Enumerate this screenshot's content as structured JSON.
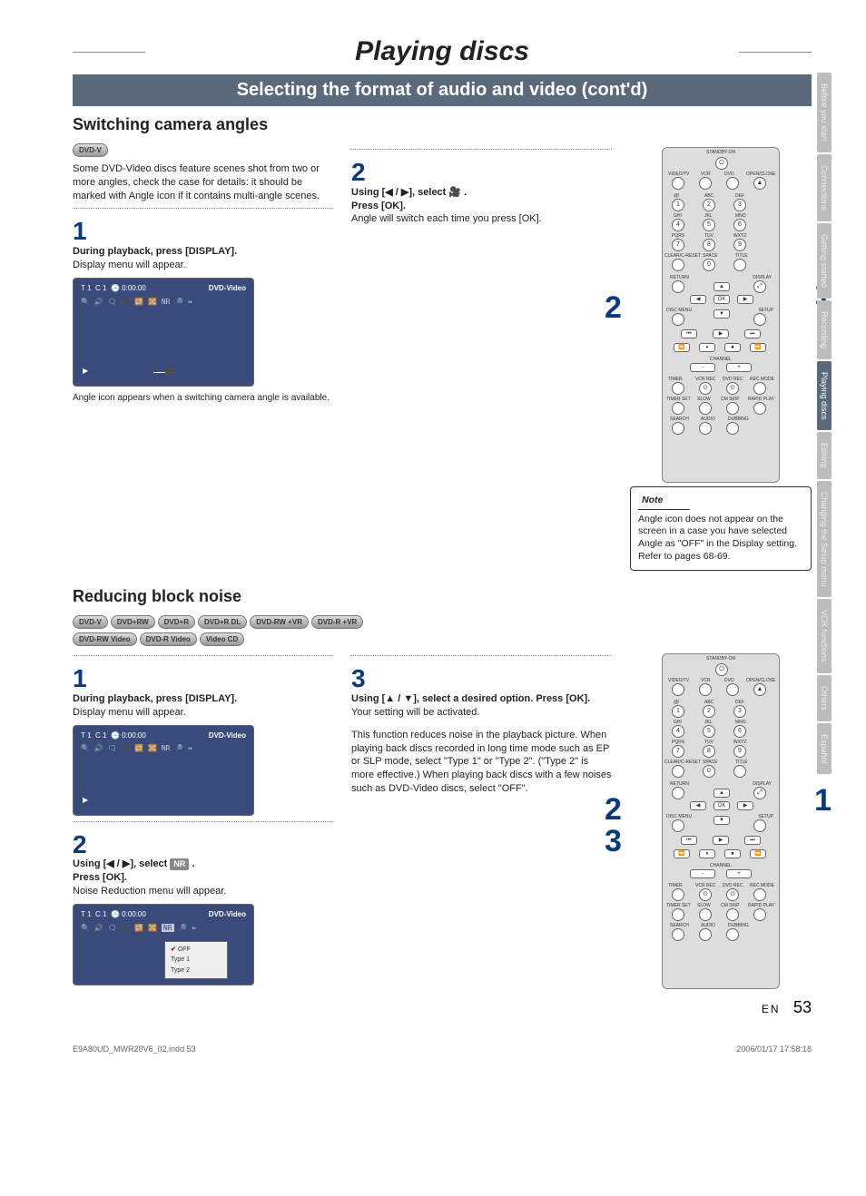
{
  "header": {
    "title": "Playing discs",
    "banner": "Selecting the format of audio and video (cont'd)"
  },
  "sidebar": {
    "tabs": [
      "Before you start",
      "Connections",
      "Getting started",
      "Recording",
      "Playing discs",
      "Editing",
      "Changing the Setup menu",
      "VCR functions",
      "Others",
      "Español"
    ],
    "active_index": 4
  },
  "angles": {
    "title": "Switching camera angles",
    "disc_badge": "DVD-V",
    "intro": "Some DVD-Video discs feature scenes shot from two or more angles, check the case for details: it should be marked with Angle icon if it contains multi-angle scenes.",
    "step1_num": "1",
    "step1_head": "During playback, press [DISPLAY].",
    "step1_body": "Display menu will appear.",
    "osd1": {
      "t": "T",
      "tval": "1",
      "c": "C",
      "cval": "1",
      "clock": "0:00:00",
      "tag": "DVD-Video"
    },
    "caption": "Angle icon appears when a switching camera angle is available.",
    "step2_num": "2",
    "step2_head_a": "Using [",
    "step2_head_b": "], select ",
    "step2_head_c": " .",
    "step2_icon": "🎥",
    "step2_line2": "Press [OK].",
    "step2_body": "Angle will switch each time you press [OK].",
    "remote_callouts": {
      "c1": "1",
      "c2": "2"
    },
    "remote": {
      "standby": "STANDBY-ON",
      "row_top": [
        "VIDEO/TV",
        "VCR",
        "DVD",
        "OPEN/CLOSE"
      ],
      "pad_labels": [
        "@!",
        "ABC",
        "DEF",
        "GHI",
        "JKL",
        "MNO",
        "PQRS",
        "TUV",
        "WXYZ"
      ],
      "row_misc": [
        "CLEAR/C-RESET",
        "SPACE",
        "TITLE"
      ],
      "return": "RETURN",
      "display": "DISPLAY",
      "ok": "OK",
      "discmenu": "DISC MENU",
      "setup": "SETUP",
      "channel": "CHANNEL",
      "ch_minus": "-",
      "ch_plus": "+",
      "row_rec": [
        "TIMER",
        "VCR REC",
        "DVD REC",
        "REC MODE"
      ],
      "row_rec2": [
        "TIMER SET",
        "SLOW",
        "CM SKIP",
        "RAPID PLAY"
      ],
      "row_rec3": [
        "SEARCH",
        "AUDIO",
        "DUBBING"
      ]
    },
    "note_title": "Note",
    "note_body": "Angle icon does not appear on the screen in a case you have selected Angle as \"OFF\" in the Display setting.\nRefer to pages 68-69."
  },
  "noise": {
    "title": "Reducing block noise",
    "discs": [
      "DVD-V",
      "DVD+RW",
      "DVD+R",
      "DVD+R DL",
      "DVD-RW +VR",
      "DVD-R +VR",
      "DVD-RW Video",
      "DVD-R Video",
      "Video CD"
    ],
    "step1_num": "1",
    "step1_head": "During playback, press [DISPLAY].",
    "step1_body": "Display menu will appear.",
    "osd2": {
      "t": "T",
      "tval": "1",
      "c": "C",
      "cval": "1",
      "clock": "0:00:00",
      "tag": "DVD-Video"
    },
    "step2_num": "2",
    "step2_head_a": "Using [",
    "step2_head_b": "], select ",
    "nr_label": "NR",
    "step2_head_c": " .",
    "step2_line2": "Press [OK].",
    "step2_body": "Noise Reduction menu will appear.",
    "osd3": {
      "t": "T",
      "tval": "1",
      "c": "C",
      "cval": "1",
      "clock": "0:00:00",
      "tag": "DVD-Video",
      "opts": [
        "OFF",
        "Type 1",
        "Type 2"
      ]
    },
    "step3_num": "3",
    "step3_head_a": "Using [",
    "step3_head_b": "], select a desired option. Press [OK].",
    "step3_body1": "Your setting will be activated.",
    "step3_body2": "This function reduces noise in the playback picture. When playing back discs recorded in long time mode such as EP or SLP mode, select \"Type 1\" or \"Type 2\". (\"Type 2\" is more effective.) When playing back discs with a few noises such as DVD-Video discs, select \"OFF\".",
    "remote_callouts": {
      "c1": "1",
      "c2": "2",
      "c3": "3"
    }
  },
  "page_footer": {
    "lang": "EN",
    "page": "53",
    "file": "E9A80UD_MWR20V6_02.indd   53",
    "date": "2006/01/17   17:58:18"
  },
  "sym": {
    "left": "◀",
    "right": "▶",
    "up": "▲",
    "down": "▼",
    "lr": "◀ / ▶",
    "ud": "▲ / ▼"
  }
}
